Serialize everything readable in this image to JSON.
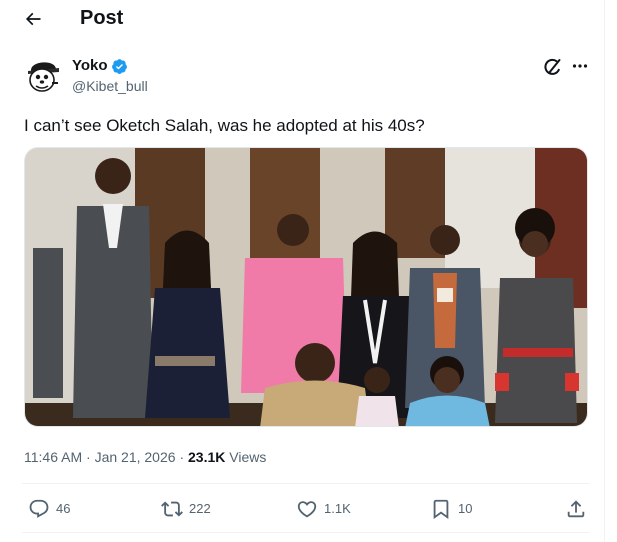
{
  "header": {
    "title": "Post",
    "back_icon": "arrow-left-icon"
  },
  "author": {
    "name": "Yoko",
    "handle": "@Kibet_bull",
    "verified_icon": "verified-badge-icon",
    "verified_color": "#1d9bf0"
  },
  "tweet": {
    "text": "I can’t see Oketch Salah, was he adopted at his 40s?"
  },
  "meta": {
    "time": "11:46 AM",
    "separator": "·",
    "date": "Jan 21, 2026",
    "views_count": "23.1K",
    "views_label": "Views"
  },
  "actions": {
    "reply": {
      "icon": "reply-icon",
      "count": "46"
    },
    "repost": {
      "icon": "repost-icon",
      "count": "222"
    },
    "like": {
      "icon": "heart-icon",
      "count": "1.1K"
    },
    "bookmark": {
      "icon": "bookmark-icon",
      "count": "10"
    },
    "share": {
      "icon": "share-icon"
    }
  },
  "colors": {
    "text_primary": "#0f1419",
    "text_secondary": "#536471",
    "divider": "#eff3f4",
    "accent": "#1d9bf0"
  }
}
